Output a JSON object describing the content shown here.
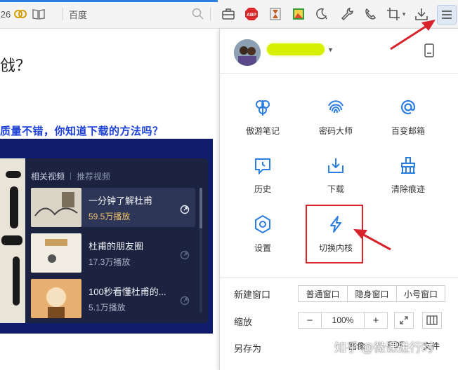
{
  "toolbar": {
    "left_fragment": "26",
    "address_text": "百度",
    "icons": [
      "honeycomb-icon",
      "reader-icon",
      "search-icon",
      "toolbox-icon",
      "adblock-icon",
      "hourglass-icon",
      "image-icon",
      "night-mode-icon",
      "wrench-icon",
      "phone-icon",
      "crop-icon",
      "download-icon",
      "menu-icon"
    ],
    "adblock_label": "ABP"
  },
  "page": {
    "heading_fragment": "戗？",
    "link_text": "质量不错，你知道下载的方法吗？",
    "video_tabs": {
      "active": "相关视频",
      "inactive": "推荐视频"
    },
    "videos": [
      {
        "title": "一分钟了解杜甫",
        "views": "59.5万播放"
      },
      {
        "title": "杜甫的朋友圈",
        "views": "17.3万播放"
      },
      {
        "title": "100秒看懂杜甫的...",
        "views": "5.1万播放"
      }
    ]
  },
  "menu": {
    "grid": [
      {
        "label": "傲游笔记",
        "icon": "notes-icon"
      },
      {
        "label": "密码大师",
        "icon": "fingerprint-icon"
      },
      {
        "label": "百变邮箱",
        "icon": "email-icon"
      },
      {
        "label": "历史",
        "icon": "history-icon"
      },
      {
        "label": "下载",
        "icon": "download-icon"
      },
      {
        "label": "清除痕迹",
        "icon": "clean-icon"
      },
      {
        "label": "设置",
        "icon": "settings-icon"
      },
      {
        "label": "切换内核",
        "icon": "lightning-icon"
      }
    ],
    "new_window": {
      "label": "新建窗口",
      "options": [
        "普通窗口",
        "隐身窗口",
        "小号窗口"
      ]
    },
    "zoom": {
      "label": "缩放",
      "minus": "−",
      "value": "100%",
      "plus": "+"
    },
    "save_as": {
      "label": "另存为",
      "options": [
        "图像",
        "PDF",
        "文件"
      ]
    }
  },
  "watermark": "知乎 @微课进行时",
  "colors": {
    "accent": "#2a7de1",
    "menu_icon": "#2a7de1",
    "highlight": "#d9232c",
    "link": "#1a3fd6"
  }
}
